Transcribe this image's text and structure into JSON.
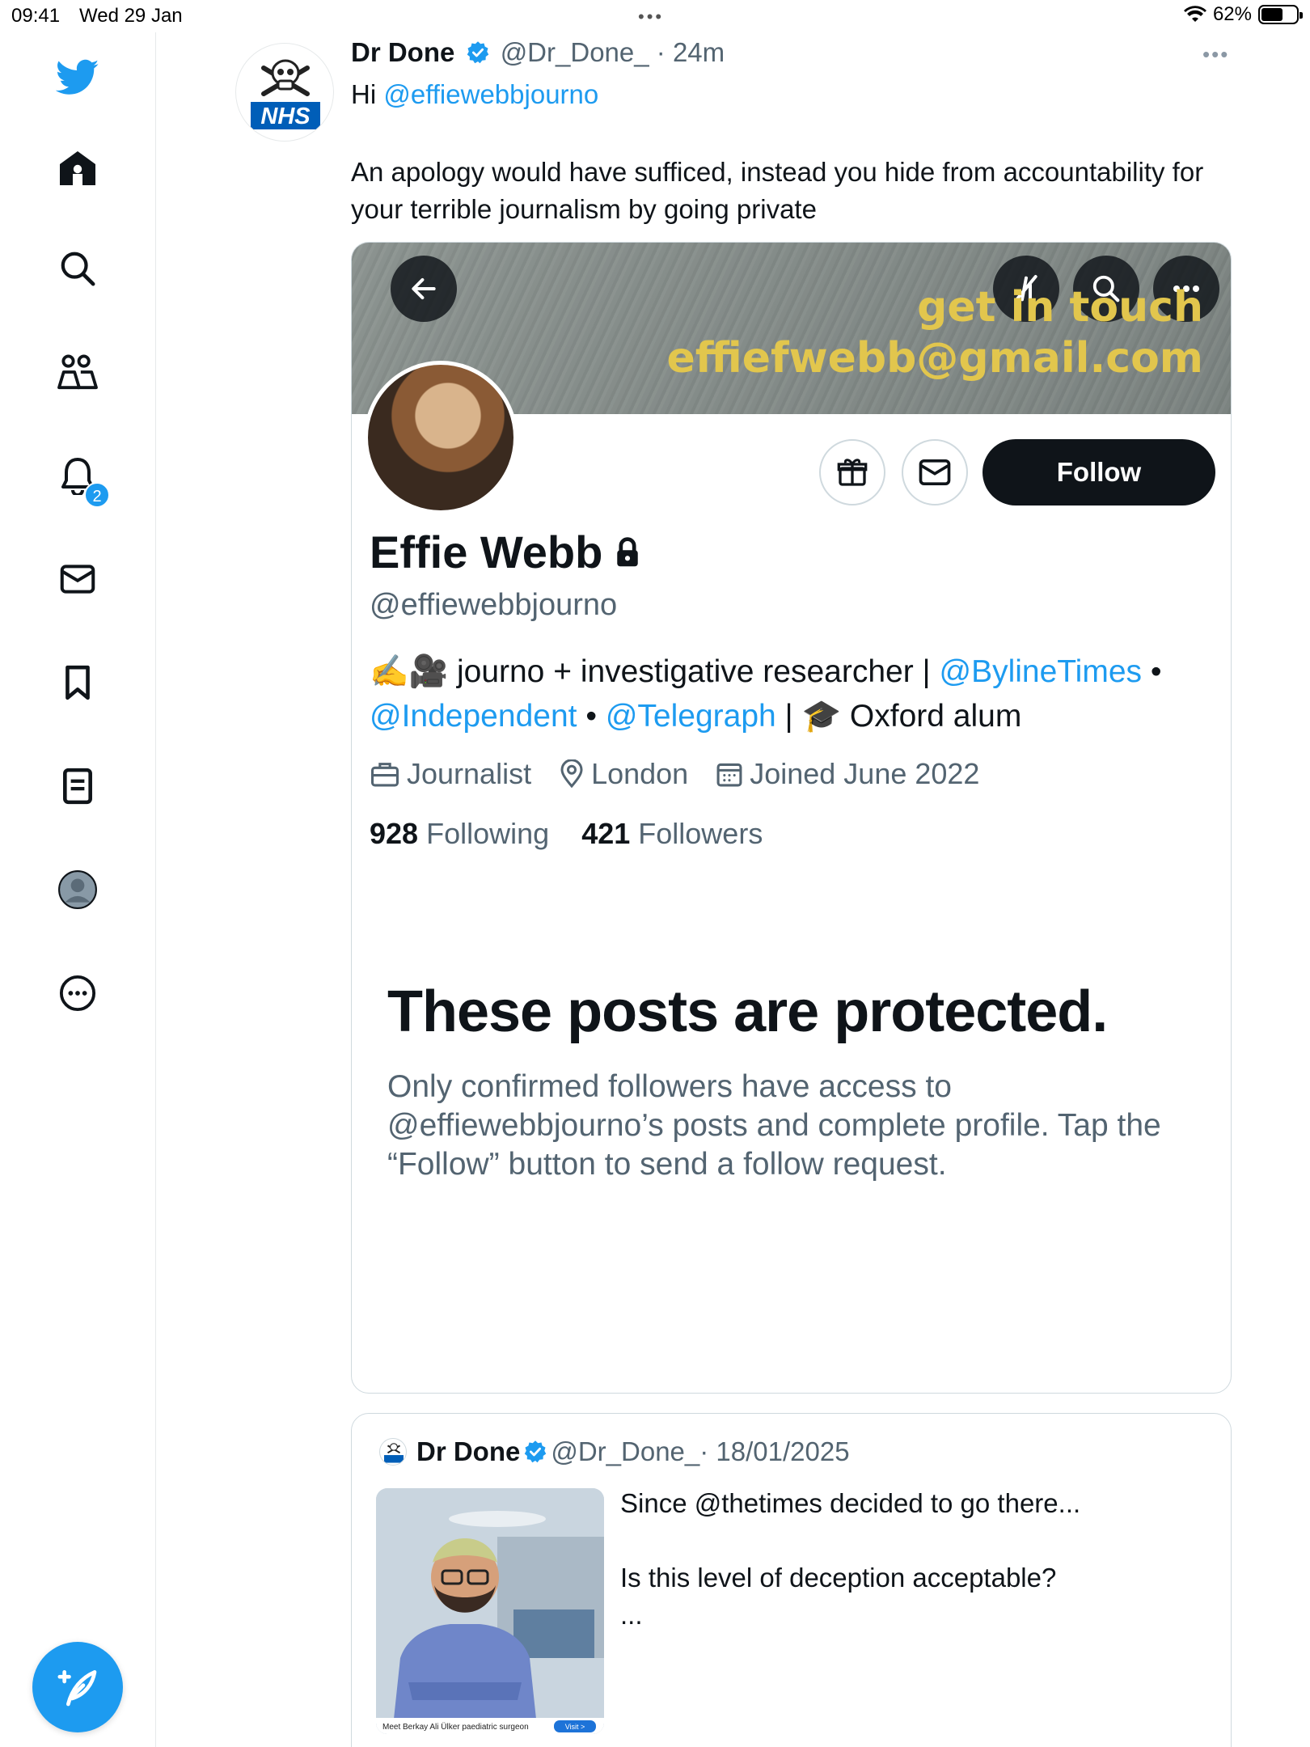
{
  "status_bar": {
    "time": "09:41",
    "date": "Wed 29 Jan",
    "battery": "62%",
    "battery_level": 0.62
  },
  "sidebar": {
    "items": [
      "twitter-logo",
      "home",
      "explore",
      "communities",
      "notifications",
      "messages",
      "bookmarks",
      "lists",
      "profile",
      "more"
    ],
    "notification_count": "2"
  },
  "tweet": {
    "author_name": "Dr Done",
    "handle": "@Dr_Done_",
    "time": "· 24m",
    "greeting": "Hi",
    "mention": "@effiewebbjourno",
    "body": "An apology would have sufficed, instead you hide from accountability for your terrible journalism by going private"
  },
  "screenshot": {
    "banner_line1": "get in touch",
    "banner_line2": "effiefwebb@gmail.com",
    "follow_label": "Follow",
    "name": "Effie Webb",
    "handle": "@effiewebbjourno",
    "bio_text1": " journo + investigative researcher | ",
    "bio_mention1": "@BylineTimes",
    "bio_sep1": " • ",
    "bio_mention2": "@Independent",
    "bio_sep2": " • ",
    "bio_mention3": "@Telegraph",
    "bio_text2": " | ",
    "bio_text3": " Oxford alum",
    "emoji_writing": "✍️",
    "emoji_camera": "🎥",
    "emoji_grad": "🎓",
    "occupation": "Journalist",
    "location": "London",
    "joined": "Joined June 2022",
    "following_count": "928",
    "following_label": "Following",
    "followers_count": "421",
    "followers_label": "Followers",
    "protected_title": "These posts are protected.",
    "protected_text": "Only confirmed followers have access to @effiewebbjourno’s posts and complete profile. Tap the “Follow” button to send a follow request."
  },
  "quoted": {
    "author_name": "Dr Done",
    "handle": "@Dr_Done_",
    "date": "· 18/01/2025",
    "line1": "Since @thetimes decided to go there...",
    "line2": "Is this level of deception acceptable?",
    "ellipsis": "...",
    "image_caption": "Meet Berkay Ali Ülker paediatric surgeon",
    "image_button": "Visit >"
  },
  "colors": {
    "accent": "#1d9bf0",
    "text": "#0f1419",
    "secondary": "#536471",
    "banner_text": "#e2c64d"
  }
}
